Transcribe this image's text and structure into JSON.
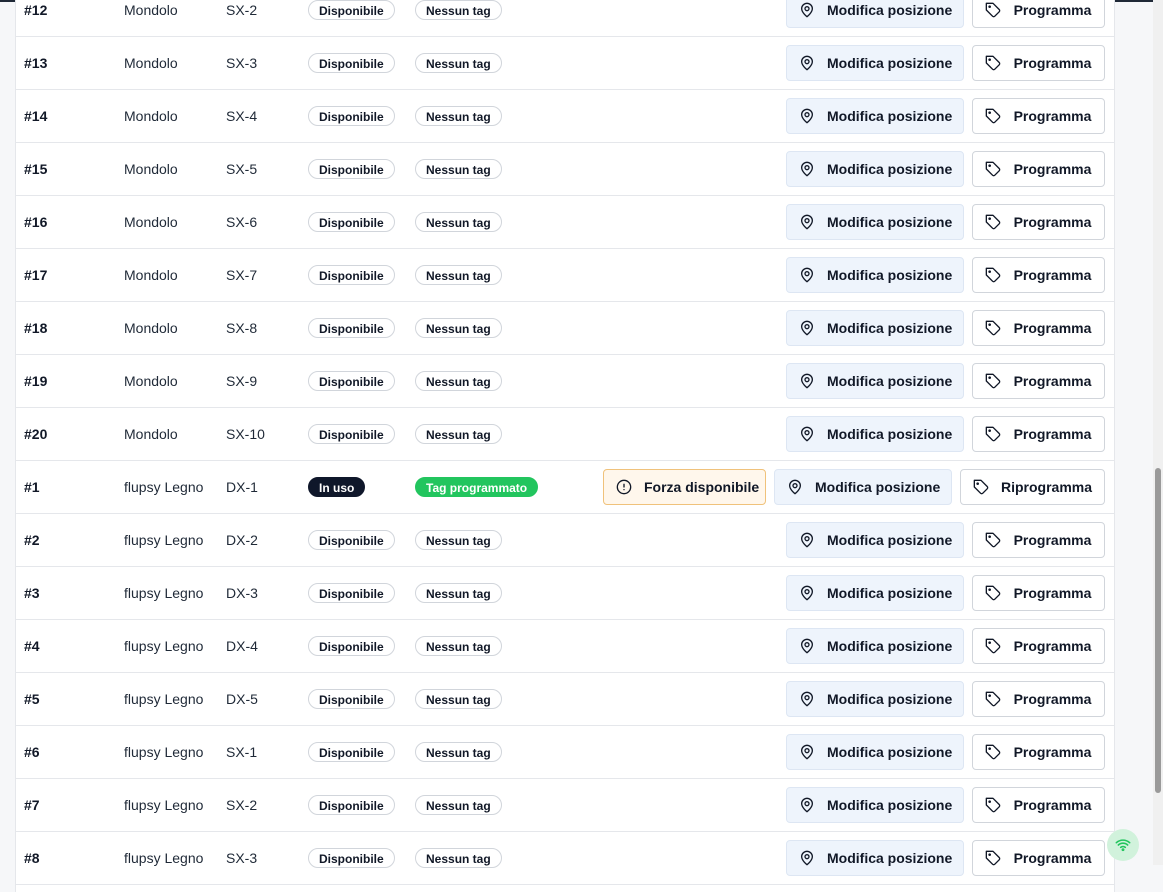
{
  "rows": [
    {
      "num": "#12",
      "name": "Mondolo",
      "pos": "SX-2",
      "status": "Disponibile",
      "tag": "Nessun tag",
      "edit": "Modifica posizione",
      "program": "Programma"
    },
    {
      "num": "#13",
      "name": "Mondolo",
      "pos": "SX-3",
      "status": "Disponibile",
      "tag": "Nessun tag",
      "edit": "Modifica posizione",
      "program": "Programma"
    },
    {
      "num": "#14",
      "name": "Mondolo",
      "pos": "SX-4",
      "status": "Disponibile",
      "tag": "Nessun tag",
      "edit": "Modifica posizione",
      "program": "Programma"
    },
    {
      "num": "#15",
      "name": "Mondolo",
      "pos": "SX-5",
      "status": "Disponibile",
      "tag": "Nessun tag",
      "edit": "Modifica posizione",
      "program": "Programma"
    },
    {
      "num": "#16",
      "name": "Mondolo",
      "pos": "SX-6",
      "status": "Disponibile",
      "tag": "Nessun tag",
      "edit": "Modifica posizione",
      "program": "Programma"
    },
    {
      "num": "#17",
      "name": "Mondolo",
      "pos": "SX-7",
      "status": "Disponibile",
      "tag": "Nessun tag",
      "edit": "Modifica posizione",
      "program": "Programma"
    },
    {
      "num": "#18",
      "name": "Mondolo",
      "pos": "SX-8",
      "status": "Disponibile",
      "tag": "Nessun tag",
      "edit": "Modifica posizione",
      "program": "Programma"
    },
    {
      "num": "#19",
      "name": "Mondolo",
      "pos": "SX-9",
      "status": "Disponibile",
      "tag": "Nessun tag",
      "edit": "Modifica posizione",
      "program": "Programma"
    },
    {
      "num": "#20",
      "name": "Mondolo",
      "pos": "SX-10",
      "status": "Disponibile",
      "tag": "Nessun tag",
      "edit": "Modifica posizione",
      "program": "Programma"
    },
    {
      "num": "#1",
      "name": "flupsy Legno",
      "pos": "DX-1",
      "status": "In uso",
      "tag": "Tag programmato",
      "force": "Forza disponibile",
      "edit": "Modifica posizione",
      "program": "Riprogramma"
    },
    {
      "num": "#2",
      "name": "flupsy Legno",
      "pos": "DX-2",
      "status": "Disponibile",
      "tag": "Nessun tag",
      "edit": "Modifica posizione",
      "program": "Programma"
    },
    {
      "num": "#3",
      "name": "flupsy Legno",
      "pos": "DX-3",
      "status": "Disponibile",
      "tag": "Nessun tag",
      "edit": "Modifica posizione",
      "program": "Programma"
    },
    {
      "num": "#4",
      "name": "flupsy Legno",
      "pos": "DX-4",
      "status": "Disponibile",
      "tag": "Nessun tag",
      "edit": "Modifica posizione",
      "program": "Programma"
    },
    {
      "num": "#5",
      "name": "flupsy Legno",
      "pos": "DX-5",
      "status": "Disponibile",
      "tag": "Nessun tag",
      "edit": "Modifica posizione",
      "program": "Programma"
    },
    {
      "num": "#6",
      "name": "flupsy Legno",
      "pos": "SX-1",
      "status": "Disponibile",
      "tag": "Nessun tag",
      "edit": "Modifica posizione",
      "program": "Programma"
    },
    {
      "num": "#7",
      "name": "flupsy Legno",
      "pos": "SX-2",
      "status": "Disponibile",
      "tag": "Nessun tag",
      "edit": "Modifica posizione",
      "program": "Programma"
    },
    {
      "num": "#8",
      "name": "flupsy Legno",
      "pos": "SX-3",
      "status": "Disponibile",
      "tag": "Nessun tag",
      "edit": "Modifica posizione",
      "program": "Programma"
    }
  ],
  "colors": {
    "in_use": "#0f172a",
    "tag_programmed": "#22c55e",
    "force_bg": "#fff7ec",
    "force_border": "#f0c27b",
    "edit_bg": "#eef4fc",
    "wifi": "#22c55e"
  },
  "icons": {
    "edit": "map-pin-icon",
    "program": "tag-icon",
    "force": "alert-circle-icon",
    "status": "wifi-icon"
  }
}
